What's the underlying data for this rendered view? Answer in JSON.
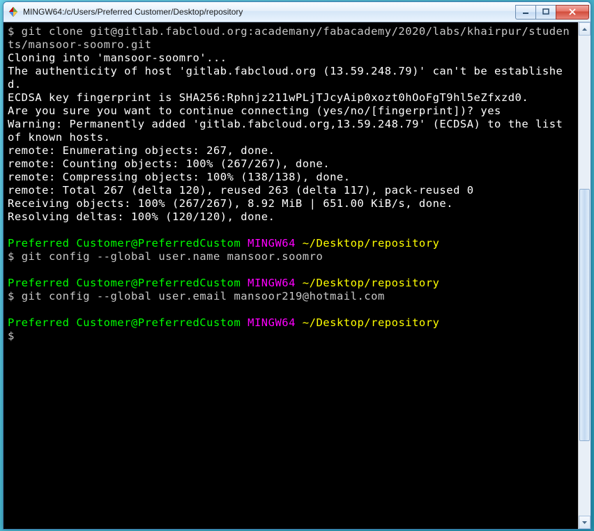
{
  "window": {
    "title": "MINGW64:/c/Users/Preferred Customer/Desktop/repository"
  },
  "prompt": {
    "user_host": "Preferred Customer@PreferredCustom",
    "env": "MINGW64",
    "path": "~/Desktop/repository",
    "symbol": "$"
  },
  "lines": {
    "l1": "$ git clone git@gitlab.fabcloud.org:academany/fabacademy/2020/labs/khairpur/students/mansoor-soomro.git",
    "l2": "Cloning into 'mansoor-soomro'...",
    "l3": "The authenticity of host 'gitlab.fabcloud.org (13.59.248.79)' can't be established.",
    "l4": "ECDSA key fingerprint is SHA256:Rphnjz211wPLjTJcyAip0xozt0hOoFgT9hl5eZfxzd0.",
    "l5": "Are you sure you want to continue connecting (yes/no/[fingerprint])? yes",
    "l6": "Warning: Permanently added 'gitlab.fabcloud.org,13.59.248.79' (ECDSA) to the list of known hosts.",
    "l7": "remote: Enumerating objects: 267, done.",
    "l8": "remote: Counting objects: 100% (267/267), done.",
    "l9": "remote: Compressing objects: 100% (138/138), done.",
    "l10": "remote: Total 267 (delta 120), reused 263 (delta 117), pack-reused 0",
    "l11": "Receiving objects: 100% (267/267), 8.92 MiB | 651.00 KiB/s, done.",
    "l12": "Resolving deltas: 100% (120/120), done.",
    "cmd1": "git config --global user.name mansoor.soomro",
    "cmd2": "git config --global user.email mansoor219@hotmail.com"
  }
}
